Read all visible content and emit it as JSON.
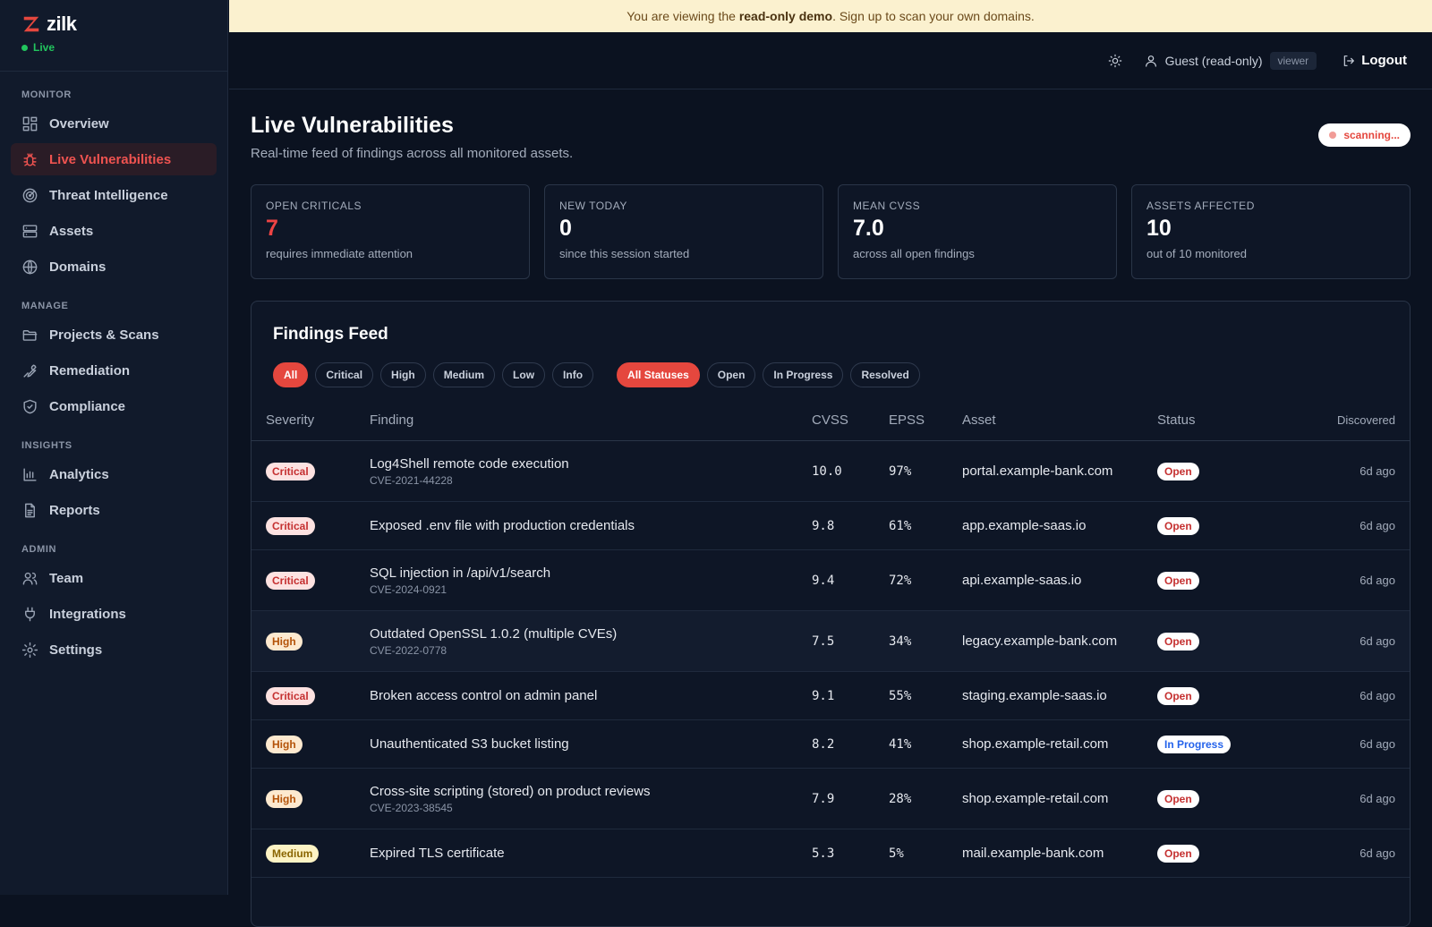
{
  "brand": {
    "name": "zilk",
    "status": "Live"
  },
  "sidebar": {
    "sections": [
      {
        "label": "MONITOR",
        "items": [
          {
            "label": "Overview",
            "icon": "grid-icon"
          },
          {
            "label": "Live Vulnerabilities",
            "icon": "bug-icon",
            "active": true
          },
          {
            "label": "Threat Intelligence",
            "icon": "radar-icon"
          },
          {
            "label": "Assets",
            "icon": "server-icon"
          },
          {
            "label": "Domains",
            "icon": "globe-icon"
          }
        ]
      },
      {
        "label": "MANAGE",
        "items": [
          {
            "label": "Projects & Scans",
            "icon": "folder-icon"
          },
          {
            "label": "Remediation",
            "icon": "wrench-icon"
          },
          {
            "label": "Compliance",
            "icon": "shield-icon"
          }
        ]
      },
      {
        "label": "INSIGHTS",
        "items": [
          {
            "label": "Analytics",
            "icon": "bar-chart-icon"
          },
          {
            "label": "Reports",
            "icon": "document-icon"
          }
        ]
      },
      {
        "label": "ADMIN",
        "items": [
          {
            "label": "Team",
            "icon": "users-icon"
          },
          {
            "label": "Integrations",
            "icon": "plug-icon"
          },
          {
            "label": "Settings",
            "icon": "gear-icon"
          }
        ]
      }
    ]
  },
  "banner": {
    "prefix": "You are viewing the ",
    "bold": "read-only demo",
    "suffix": ". Sign up to scan your own domains."
  },
  "topbar": {
    "user": "Guest (read-only)",
    "role": "viewer",
    "logout": "Logout"
  },
  "page": {
    "title": "Live Vulnerabilities",
    "subtitle": "Real-time feed of findings across all monitored assets.",
    "scan_status": "scanning..."
  },
  "stats": [
    {
      "label": "OPEN CRITICALS",
      "value": "7",
      "note": "requires immediate attention",
      "accent": "#ef4444"
    },
    {
      "label": "NEW TODAY",
      "value": "0",
      "note": "since this session started"
    },
    {
      "label": "MEAN CVSS",
      "value": "7.0",
      "note": "across all open findings"
    },
    {
      "label": "ASSETS AFFECTED",
      "value": "10",
      "note": "out of 10 monitored"
    }
  ],
  "feed": {
    "title": "Findings Feed",
    "severity_filters": [
      "All",
      "Critical",
      "High",
      "Medium",
      "Low",
      "Info"
    ],
    "status_filters": [
      "All Statuses",
      "Open",
      "In Progress",
      "Resolved"
    ],
    "columns": {
      "severity": "Severity",
      "finding": "Finding",
      "cvss": "CVSS",
      "epss": "EPSS",
      "asset": "Asset",
      "status": "Status",
      "discovered": "Discovered"
    },
    "rows": [
      {
        "severity": "Critical",
        "title": "Log4Shell remote code execution",
        "cve": "CVE-2021-44228",
        "cvss": "10.0",
        "epss": "97%",
        "asset": "portal.example-bank.com",
        "status": "Open",
        "discovered": "6d ago"
      },
      {
        "severity": "Critical",
        "title": "Exposed .env file with production credentials",
        "cve": "",
        "cvss": "9.8",
        "epss": "61%",
        "asset": "app.example-saas.io",
        "status": "Open",
        "discovered": "6d ago"
      },
      {
        "severity": "Critical",
        "title": "SQL injection in /api/v1/search",
        "cve": "CVE-2024-0921",
        "cvss": "9.4",
        "epss": "72%",
        "asset": "api.example-saas.io",
        "status": "Open",
        "discovered": "6d ago"
      },
      {
        "severity": "High",
        "title": "Outdated OpenSSL 1.0.2 (multiple CVEs)",
        "cve": "CVE-2022-0778",
        "cvss": "7.5",
        "epss": "34%",
        "asset": "legacy.example-bank.com",
        "status": "Open",
        "discovered": "6d ago",
        "highlight": true
      },
      {
        "severity": "Critical",
        "title": "Broken access control on admin panel",
        "cve": "",
        "cvss": "9.1",
        "epss": "55%",
        "asset": "staging.example-saas.io",
        "status": "Open",
        "discovered": "6d ago"
      },
      {
        "severity": "High",
        "title": "Unauthenticated S3 bucket listing",
        "cve": "",
        "cvss": "8.2",
        "epss": "41%",
        "asset": "shop.example-retail.com",
        "status": "In Progress",
        "discovered": "6d ago"
      },
      {
        "severity": "High",
        "title": "Cross-site scripting (stored) on product reviews",
        "cve": "CVE-2023-38545",
        "cvss": "7.9",
        "epss": "28%",
        "asset": "shop.example-retail.com",
        "status": "Open",
        "discovered": "6d ago"
      },
      {
        "severity": "Medium",
        "title": "Expired TLS certificate",
        "cve": "",
        "cvss": "5.3",
        "epss": "5%",
        "asset": "mail.example-bank.com",
        "status": "Open",
        "discovered": "6d ago"
      }
    ]
  }
}
